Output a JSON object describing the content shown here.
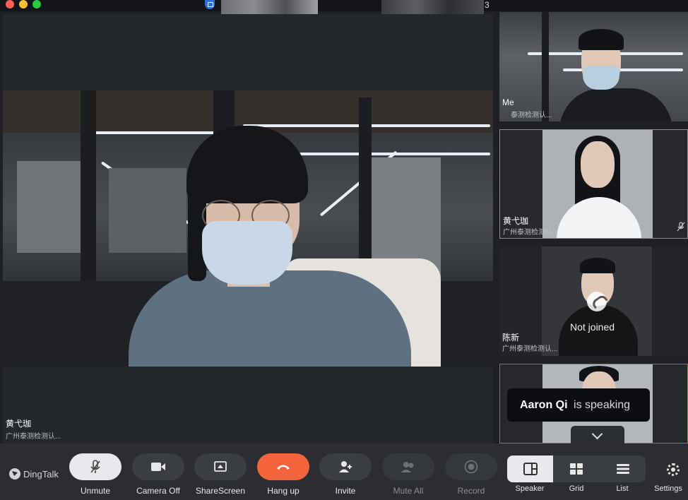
{
  "titlebar": {
    "participant_count": "3"
  },
  "main": {
    "speaker_name": "黄弋珈",
    "speaker_org": "广州泰测检测认..."
  },
  "tiles": [
    {
      "name": "Me",
      "org": "泰测检测认..."
    },
    {
      "name": "黄弋珈",
      "org": "广州泰测检测认..."
    },
    {
      "name": "陈新",
      "org": "广州泰测检测认...",
      "status": "Not joined"
    },
    {
      "name": "Aaron Qi",
      "speaking_suffix": "is speaking"
    }
  ],
  "toolbar": {
    "brand": "DingTalk",
    "unmute": "Unmute",
    "camera_off": "Camera Off",
    "share_screen": "ShareScreen",
    "hang_up": "Hang up",
    "invite": "Invite",
    "mute_all": "Mute All",
    "record": "Record",
    "speaker": "Speaker",
    "grid": "Grid",
    "list": "List",
    "settings": "Settings"
  },
  "colors": {
    "hangup": "#f3643c",
    "speaking_border": "#3b9e4d",
    "background": "#1e2024"
  }
}
